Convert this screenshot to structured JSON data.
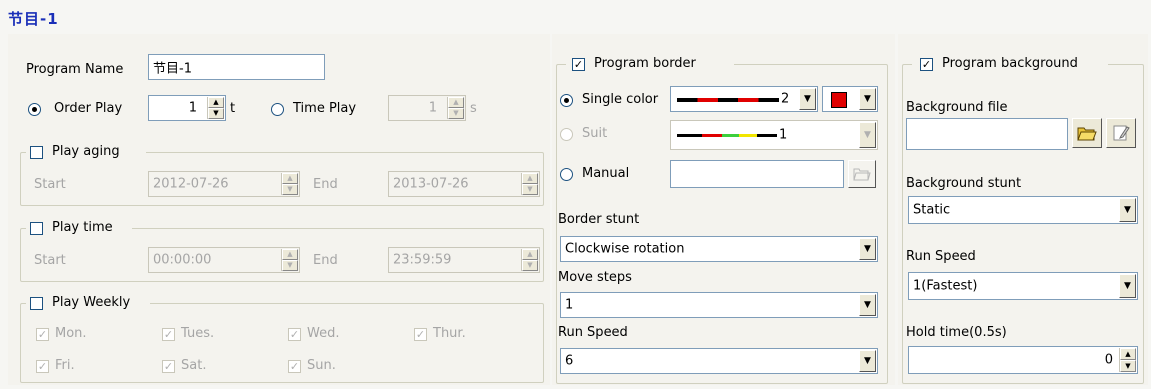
{
  "title": "节目-1",
  "program": {
    "name_label": "Program Name",
    "name_value": "节目-1",
    "order_play_label": "Order Play",
    "order_play_value": "1",
    "order_play_unit": "t",
    "time_play_label": "Time Play",
    "time_play_value": "1",
    "time_play_unit": "s"
  },
  "play_aging": {
    "label": "Play aging",
    "start_label": "Start",
    "start_value": "2012-07-26",
    "end_label": "End",
    "end_value": "2013-07-26"
  },
  "play_time": {
    "label": "Play time",
    "start_label": "Start",
    "start_value": "00:00:00",
    "end_label": "End",
    "end_value": "23:59:59"
  },
  "play_weekly": {
    "label": "Play Weekly",
    "days": [
      "Mon.",
      "Tues.",
      "Wed.",
      "Thur.",
      "Fri.",
      "Sat.",
      "Sun."
    ]
  },
  "border": {
    "label": "Program border",
    "single_color_label": "Single color",
    "single_color_width": "2",
    "suit_label": "Suit",
    "suit_width": "1",
    "manual_label": "Manual",
    "stunt_label": "Border stunt",
    "stunt_value": "Clockwise rotation",
    "move_steps_label": "Move steps",
    "move_steps_value": "1",
    "run_speed_label": "Run Speed",
    "run_speed_value": "6",
    "color": "#e00000"
  },
  "background": {
    "label": "Program background",
    "file_label": "Background file",
    "file_value": "",
    "stunt_label": "Background stunt",
    "stunt_value": "Static",
    "run_speed_label": "Run Speed",
    "run_speed_value": "1(Fastest)",
    "hold_time_label": "Hold time(0.5s)",
    "hold_time_value": "0"
  }
}
